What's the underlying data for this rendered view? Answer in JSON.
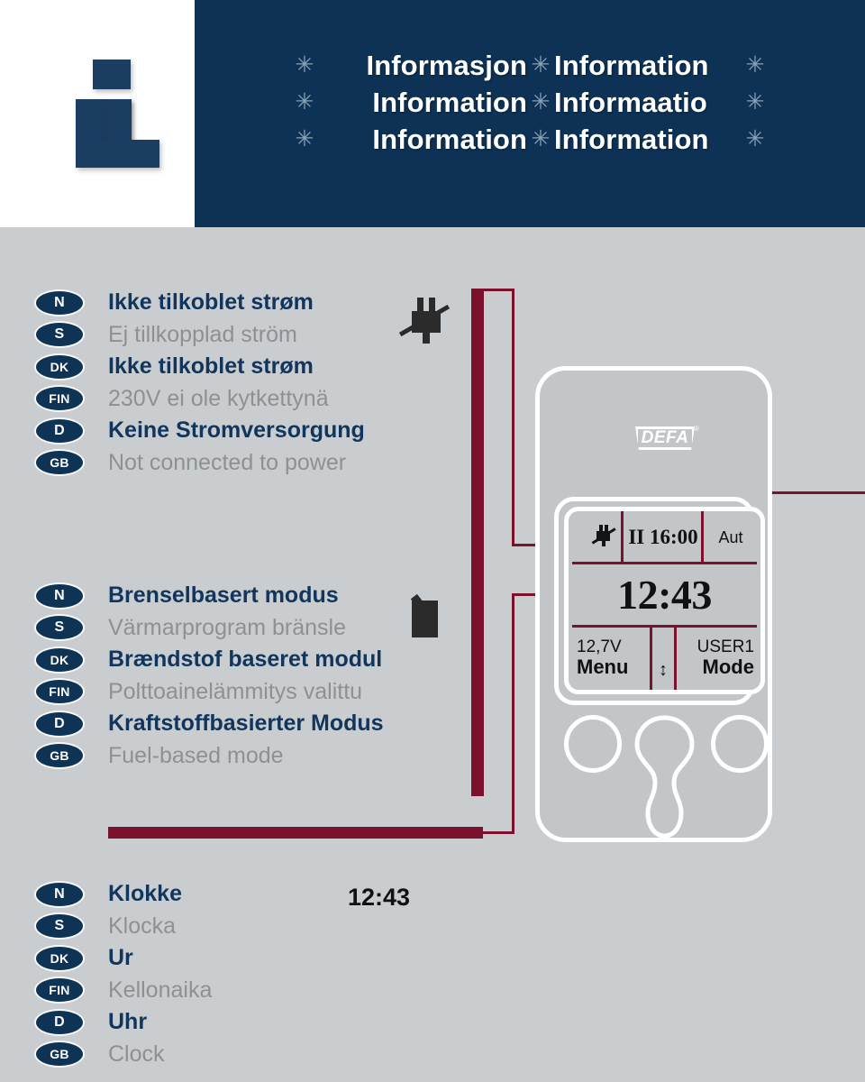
{
  "header": {
    "icon": "info-icon",
    "rows": [
      {
        "left": "Informasjon",
        "right": "Information"
      },
      {
        "left": "Information",
        "right": "Informaatio"
      },
      {
        "left": "Information",
        "right": "Information"
      }
    ],
    "flake": "✳",
    "colors": {
      "navy": "#0d3255",
      "white": "#ffffff"
    }
  },
  "blocks": [
    {
      "id": "not-connected-to-power",
      "icon": "crossed-plug-icon",
      "rows": [
        {
          "lang": "N",
          "text": "Ikke tilkoblet strøm",
          "style": "dark"
        },
        {
          "lang": "S",
          "text": "Ej tillkopplad ström",
          "style": "gray"
        },
        {
          "lang": "DK",
          "text": "Ikke tilkoblet strøm",
          "style": "dark"
        },
        {
          "lang": "FIN",
          "text": "230V ei ole kytkettynä",
          "style": "gray"
        },
        {
          "lang": "D",
          "text": "Keine Stromversorgung",
          "style": "dark"
        },
        {
          "lang": "GB",
          "text": "Not connected to power",
          "style": "gray"
        }
      ]
    },
    {
      "id": "fuel-based-mode",
      "icon": "fuel-heater-icon",
      "rows": [
        {
          "lang": "N",
          "text": "Brenselbasert modus",
          "style": "dark"
        },
        {
          "lang": "S",
          "text": "Värmarprogram bränsle",
          "style": "gray"
        },
        {
          "lang": "DK",
          "text": "Brændstof baseret modul",
          "style": "dark"
        },
        {
          "lang": "FIN",
          "text": "Polttoainelämmitys valittu",
          "style": "gray"
        },
        {
          "lang": "D",
          "text": "Kraftstoffbasierter Modus",
          "style": "dark"
        },
        {
          "lang": "GB",
          "text": "Fuel-based mode",
          "style": "gray"
        }
      ]
    },
    {
      "id": "clock",
      "value": "12:43",
      "rows": [
        {
          "lang": "N",
          "text": "Klokke",
          "style": "dark"
        },
        {
          "lang": "S",
          "text": "Klocka",
          "style": "gray"
        },
        {
          "lang": "DK",
          "text": "Ur",
          "style": "dark"
        },
        {
          "lang": "FIN",
          "text": "Kellonaika",
          "style": "gray"
        },
        {
          "lang": "D",
          "text": "Uhr",
          "style": "dark"
        },
        {
          "lang": "GB",
          "text": "Clock",
          "style": "gray"
        }
      ]
    }
  ],
  "device": {
    "brand": "DEFA",
    "brand_mark": "®",
    "screen": {
      "status_icon": "crossed-plug-icon",
      "program": "II 16:00",
      "auto": "Aut",
      "clock": "12:43",
      "voltage": "12,7V",
      "left_key": "Menu",
      "user": "USER1",
      "right_key": "Mode",
      "arrows": "↕"
    },
    "buttons": [
      "left-button",
      "center-rocker-button",
      "right-button"
    ]
  },
  "colors": {
    "background": "#c9cdcf",
    "header_navy": "#0d3255",
    "text_dark": "#11355c",
    "text_gray": "#8e9194",
    "connector_red": "#7a122e",
    "device_body": "#c2c6c8"
  }
}
